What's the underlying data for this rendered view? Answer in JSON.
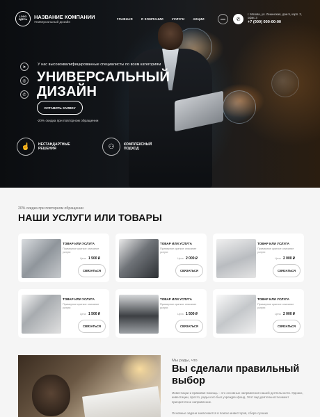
{
  "header": {
    "logo_line1": "LOGO",
    "logo_line2": "ЗДЕСЬ",
    "company_name": "НАЗВАНИЕ КОМПАНИИ",
    "company_sub": "Универсальный дизайн",
    "nav": [
      "ГЛАВНАЯ",
      "О КОМПАНИИ",
      "УСЛУГИ",
      "АКЦИИ"
    ],
    "address": "г. Москва, ул. Ленинская, дом 5, корп. 3, офис 3",
    "phone": "+7 (000) 000-00-00",
    "phone_icon": "✆"
  },
  "hero": {
    "pre": "У нас высококвалифицированные специалисты по всем категориям",
    "title_line1": "УНИВЕРСАЛЬНЫЙ",
    "title_line2": "ДИЗАЙН",
    "cta": "ОСТАВИТЬ ЗАЯВКУ",
    "discount": "-20% скидка при повторном обращении",
    "socials": [
      {
        "icon": "telegram-icon",
        "glyph": "➤"
      },
      {
        "icon": "instagram-icon",
        "glyph": "◎"
      },
      {
        "icon": "whatsapp-icon",
        "glyph": "✆"
      }
    ],
    "features": [
      {
        "icon": "hand-icon",
        "glyph": "☝",
        "text": "НЕСТАНДАРТНЫЕ РЕШЕНИЯ"
      },
      {
        "icon": "users-icon",
        "glyph": "⚇",
        "text": "КОМПЛЕКСНЫЙ ПОДХОД"
      }
    ]
  },
  "services": {
    "pre": "20% скидка при повторном обращении",
    "title": "НАШИ УСЛУГИ ИЛИ ТОВАРЫ",
    "cards": [
      {
        "name": "ТОВАР ИЛИ УСЛУГА",
        "desc": "Примерное краткое описание услуги",
        "price_label": "Цена",
        "price": "1 500 ₽",
        "button": "СВЯЗАТЬСЯ"
      },
      {
        "name": "ТОВАР ИЛИ УСЛУГА",
        "desc": "Примерное краткое описание услуги",
        "price_label": "Цена",
        "price": "2 000 ₽",
        "button": "СВЯЗАТЬСЯ"
      },
      {
        "name": "ТОВАР ИЛИ УСЛУГА",
        "desc": "Примерное краткое описание услуги",
        "price_label": "Цена",
        "price": "2 000 ₽",
        "button": "СВЯЗАТЬСЯ"
      },
      {
        "name": "ТОВАР ИЛИ УСЛУГА",
        "desc": "Примерное краткое описание услуги",
        "price_label": "Цена",
        "price": "1 500 ₽",
        "button": "СВЯЗАТЬСЯ"
      },
      {
        "name": "ТОВАР ИЛИ УСЛУГА",
        "desc": "Примерное краткое описание услуги",
        "price_label": "Цена",
        "price": "1 500 ₽",
        "button": "СВЯЗАТЬСЯ"
      },
      {
        "name": "ТОВАР ИЛИ УСЛУГА",
        "desc": "Примерное краткое описание услуги",
        "price_label": "Цена",
        "price": "2 000 ₽",
        "button": "СВЯЗАТЬСЯ"
      }
    ]
  },
  "about": {
    "pre": "Мы рады, что",
    "title": "Вы сделали правильный выбор",
    "text": "Инвестиции и правовая помощь – это основные направления нашей деятельности. Однако, инвестиции, просто, рады кого был учреждён фонд. Этот вид деятельности имеет приоритетное направление.",
    "text2": "Основные задачи заключаются в поиске инвесторов, сборе лучших"
  }
}
